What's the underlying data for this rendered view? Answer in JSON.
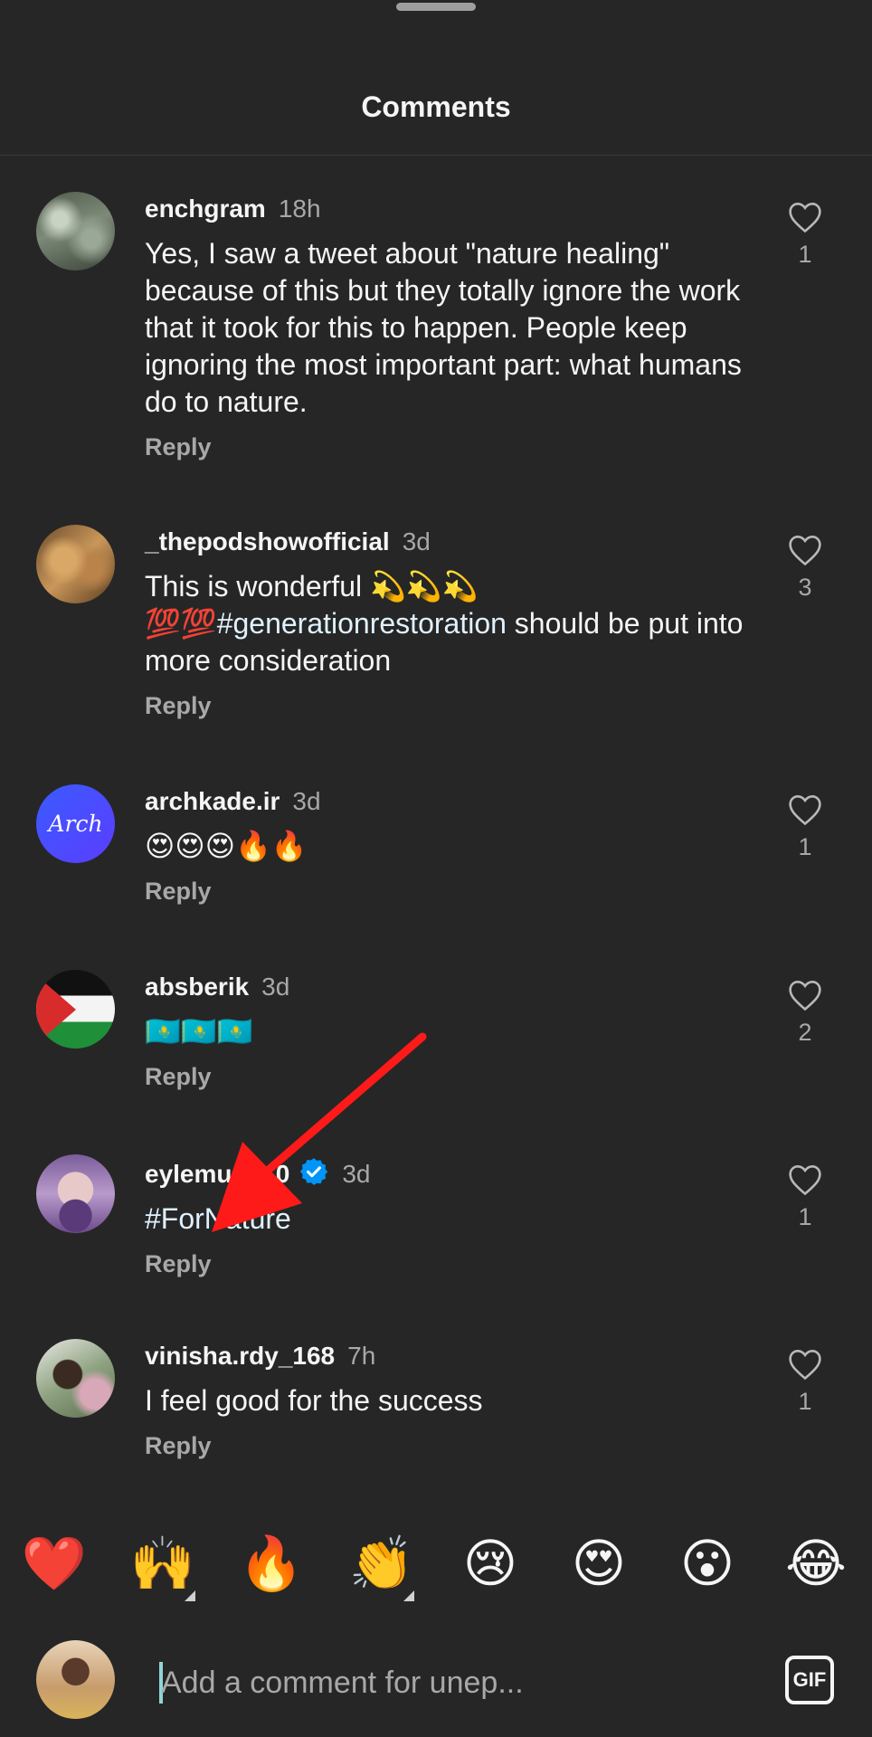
{
  "header": {
    "title": "Comments"
  },
  "comments": [
    {
      "username": "enchgram",
      "time": "18h",
      "text": "Yes, I saw a tweet about \"nature healing\" because of this but they totally ignore the work that it took for this to happen. People keep ignoring the most important part: what humans do to nature.",
      "reply_label": "Reply",
      "likes": "1"
    },
    {
      "username": "_thepodshowofficial",
      "time": "3d",
      "text_part1": "This is wonderful 💫💫💫",
      "text_part2": "💯💯",
      "hashtag": "#generationrestoration",
      "text_part3": "  should be put into more consideration",
      "reply_label": "Reply",
      "likes": "3"
    },
    {
      "username": "archkade.ir",
      "time": "3d",
      "avatar_text": "Arch",
      "text": "😍😍😍🔥🔥",
      "reply_label": "Reply",
      "likes": "1"
    },
    {
      "username": "absberik",
      "time": "3d",
      "text": "🇰🇿🇰🇿🇰🇿",
      "reply_label": "Reply",
      "likes": "2"
    },
    {
      "username": "eylemun  e  0",
      "time": "3d",
      "verified": true,
      "text": "#ForNature",
      "reply_label": "Reply",
      "likes": "1"
    },
    {
      "username": "vinisha.rdy_168",
      "time": "7h",
      "text": "I feel good for the success",
      "reply_label": "Reply",
      "likes": "1"
    }
  ],
  "reactions": [
    "❤️",
    "🙌",
    "🔥",
    "👏",
    "😢",
    "😍",
    "😮",
    "😂"
  ],
  "composer": {
    "placeholder": "Add a comment for unep...",
    "gif_label": "GIF"
  },
  "colors": {
    "background": "#262626",
    "secondary_text": "#a8a8a8",
    "verified_blue": "#0095f6",
    "annotation_arrow": "#ff1a1a"
  }
}
